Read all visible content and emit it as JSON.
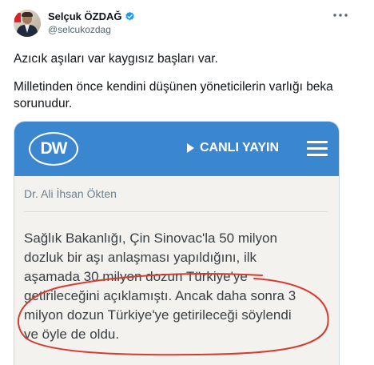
{
  "tweet": {
    "display_name": "Selçuk ÖZDAĞ",
    "handle": "@selcukozdag",
    "paragraphs": [
      "Azıcık aşıları var kaygısız başları var.",
      "Milletinden önce kendini düşünen yöneticilerin varlığı beka sorunudur."
    ]
  },
  "media": {
    "logo_text": "DW",
    "live_label": "CANLI YAYIN",
    "author": "Dr. Ali İhsan Ökten",
    "article_lines": [
      "Sağlık Bakanlığı, Çin Sinovac'la 50 milyon",
      "dozluk bir aşı anlaşması yapıldığını, ilk",
      "aşamada 30 milyon dozun Türkiye'ye",
      "getirileceğini açıklamıştı. Ancak daha sonra 3",
      "milyon dozun Türkiye'ye getirileceği söylendi",
      "ve öyle de oldu."
    ]
  },
  "colors": {
    "dw_blue": "#3a87d0",
    "verified_blue": "#1d9bf0",
    "annotation_red": "#d63b2f"
  },
  "icons": [
    "verified-badge-icon",
    "more-options-icon",
    "play-icon",
    "hamburger-menu-icon"
  ]
}
